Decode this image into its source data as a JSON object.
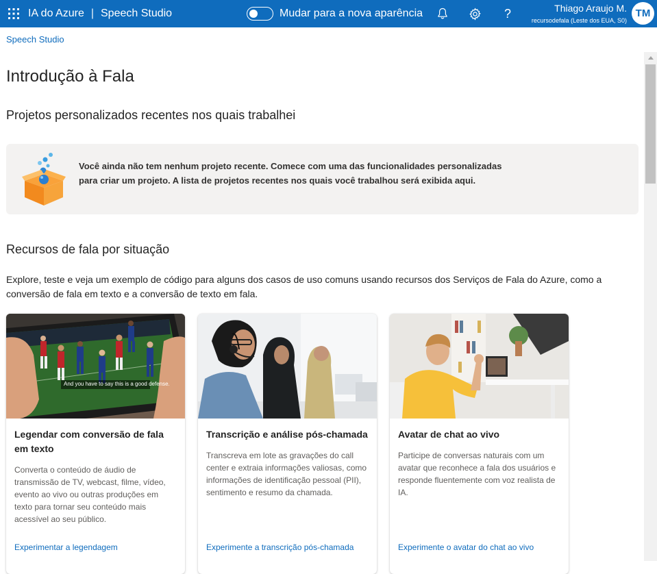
{
  "topbar": {
    "app_name": "IA do Azure",
    "separator": "|",
    "product": "Speech Studio",
    "toggle_label": "Mudar para a nova aparência",
    "help_glyph": "?",
    "user_name": "Thiago Araujo M.",
    "user_resource": "recursodefala (Leste dos EUA, S0)",
    "avatar_initials": "TM",
    "icons": [
      "waffle-icon",
      "bell-icon",
      "gear-icon",
      "help-icon"
    ]
  },
  "breadcrumb": "Speech Studio",
  "page": {
    "title": "Introdução à Fala",
    "recent_heading": "Projetos personalizados recentes nos quais trabalhei",
    "empty_message": "Você ainda não tem nenhum projeto recente. Comece com uma das funcionalidades personalizadas para criar um projeto. A lista de projetos recentes nos quais você trabalhou será exibida aqui.",
    "scenarios_heading": "Recursos de fala por situação",
    "scenarios_intro": "Explore, teste e veja um exemplo de código para alguns dos casos de uso comuns usando recursos dos Serviços de Fala do Azure, como a conversão de fala em texto e a conversão de texto em fala."
  },
  "cards": [
    {
      "title": "Legendar com conversão de fala em texto",
      "description": "Converta o conteúdo de áudio de transmissão de TV, webcast, filme, vídeo, evento ao vivo ou outras produções em texto para tornar seu conteúdo mais acessível ao seu público.",
      "link": "Experimentar a legendagem",
      "image_caption": "And you have to say this is a good defense."
    },
    {
      "title": "Transcrição e análise pós-chamada",
      "description": "Transcreva em lote as gravações do call center e extraia informações valiosas, como informações de identificação pessoal (PII), sentimento e resumo da chamada.",
      "link": "Experimente a transcrição pós-chamada"
    },
    {
      "title": "Avatar de chat ao vivo",
      "description": "Participe de conversas naturais com um avatar que reconhece a fala dos usuários e responde fluentemente com voz realista de IA.",
      "link": "Experimente o avatar do chat ao vivo"
    }
  ],
  "colors": {
    "brand": "#0f6cbd",
    "panel": "#f3f2f1",
    "link": "#0f6cbd"
  }
}
